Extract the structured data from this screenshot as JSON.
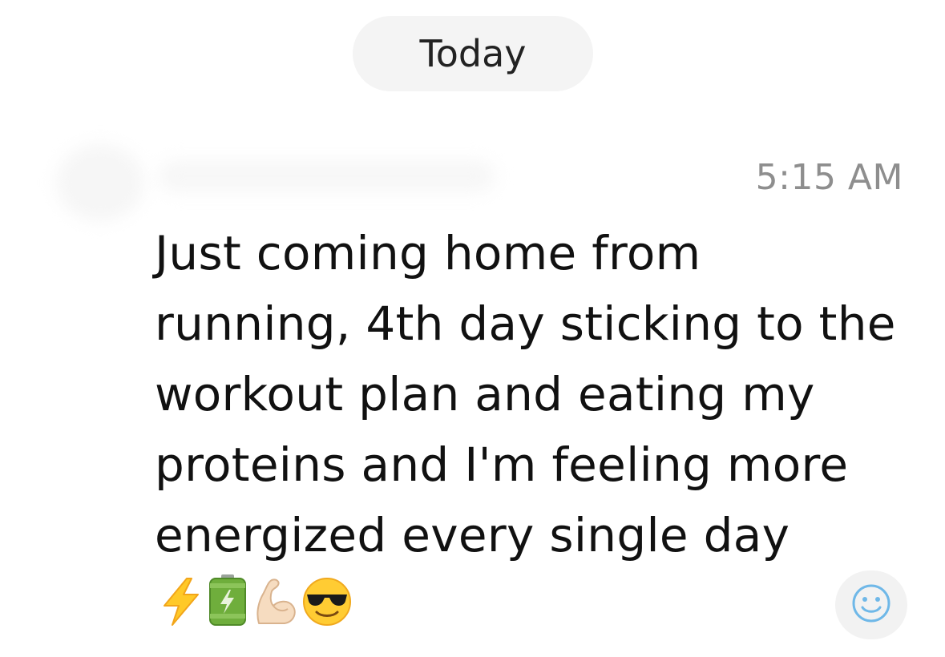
{
  "header": {
    "date_label": "Today"
  },
  "message": {
    "timestamp": "5:15 AM",
    "text": "Just coming home from running, 4th day sticking to the workout plan and eating my proteins and I'm feeling more energized every single day",
    "emojis": [
      "high-voltage-icon",
      "battery-icon",
      "flexed-biceps-icon",
      "sunglasses-face-icon"
    ]
  },
  "reaction": {
    "icon": "smiley-icon"
  },
  "colors": {
    "pill_bg": "#f4f4f4",
    "timestamp": "#8e8e8e",
    "react_bg": "#f2f2f2",
    "react_icon": "#6fb8e8"
  }
}
